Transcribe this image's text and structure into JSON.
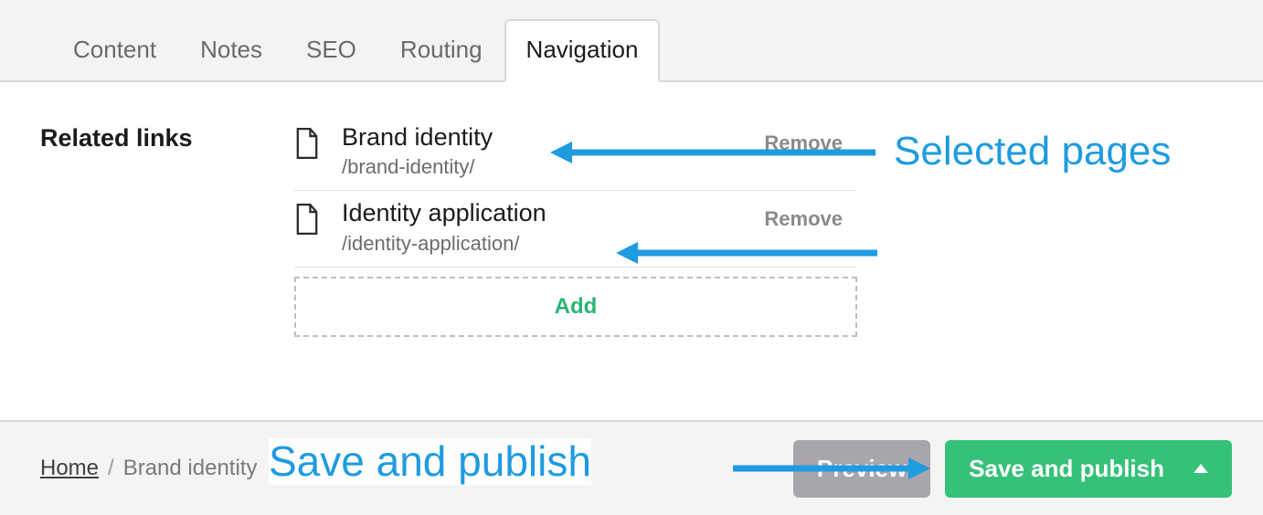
{
  "tabs": {
    "items": [
      "Content",
      "Notes",
      "SEO",
      "Routing",
      "Navigation"
    ],
    "activeIndex": 4
  },
  "section": {
    "label": "Related links",
    "links": [
      {
        "title": "Brand identity",
        "path": "/brand-identity/",
        "remove": "Remove"
      },
      {
        "title": "Identity application",
        "path": "/identity-application/",
        "remove": "Remove"
      }
    ],
    "add": "Add"
  },
  "footer": {
    "breadcrumbs": {
      "home": "Home",
      "sep": "/",
      "current": "Brand identity"
    },
    "preview": "Preview",
    "publish": "Save and publish"
  },
  "annotations": {
    "selected": "Selected pages",
    "savepub": "Save and publish"
  },
  "colors": {
    "accent_blue": "#1f9be0",
    "accent_green": "#35c178"
  }
}
